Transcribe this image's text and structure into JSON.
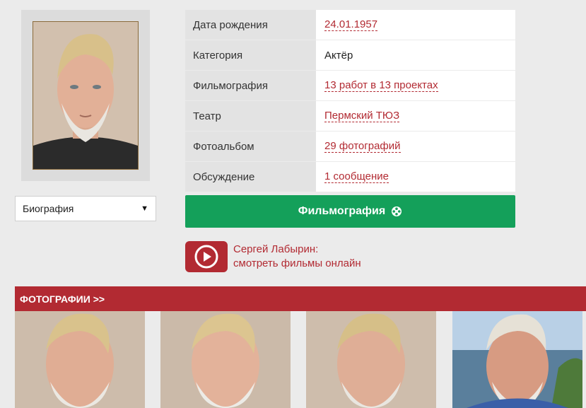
{
  "biography_select": {
    "selected": "Биография"
  },
  "info": {
    "rows": [
      {
        "label": "Дата рождения",
        "value": "24.01.1957",
        "link": true
      },
      {
        "label": "Категория",
        "value": "Актёр",
        "link": false
      },
      {
        "label": "Фильмография",
        "value": "13 работ в 13 проектах",
        "link": true
      },
      {
        "label": "Театр",
        "value": "Пермский ТЮЗ",
        "link": true
      },
      {
        "label": "Фотоальбом",
        "value": "29 фотографий",
        "link": true
      },
      {
        "label": "Обсуждение",
        "value": "1 сообщение",
        "link": true
      }
    ]
  },
  "filmography_button": {
    "label": "Фильмография",
    "icon": "film-reel-icon"
  },
  "watch_online": {
    "line1": "Сергей Лабырин:",
    "line2": "смотреть фильмы онлайн",
    "icon": "play-icon"
  },
  "photos": {
    "header": "ФОТОГРАФИИ >>"
  },
  "colors": {
    "accent_red": "#b22a32",
    "green": "#14a05a",
    "background": "#ebebeb"
  }
}
